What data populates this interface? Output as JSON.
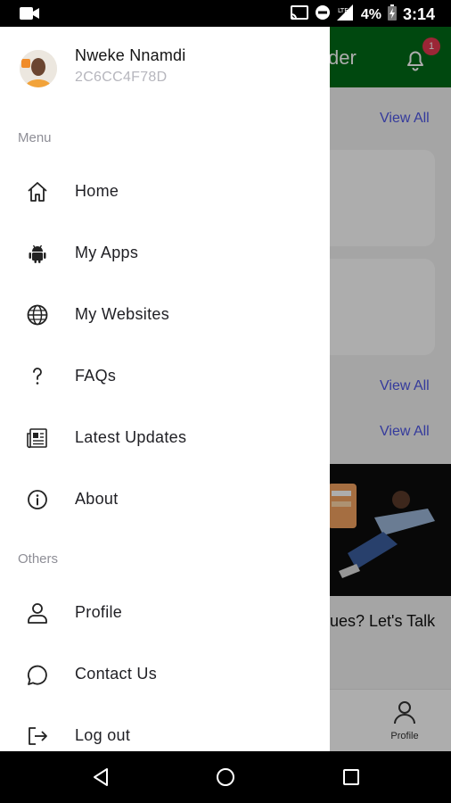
{
  "status_bar": {
    "battery_text": "4%",
    "time": "3:14"
  },
  "background_app": {
    "header_title_partial": "der",
    "notification_count": "1",
    "view_all_label": "View All",
    "promo_text_partial": "ues? Let's Talk",
    "bottom_nav_profile_label": "Profile",
    "colors": {
      "header": "#006a17",
      "link": "#4d56e6",
      "badge": "#e53950"
    }
  },
  "drawer": {
    "user": {
      "name": "Nweke Nnamdi",
      "id": "2C6CC4F78D"
    },
    "sections": [
      {
        "title": "Menu",
        "items": [
          {
            "label": "Home",
            "icon": "home-icon"
          },
          {
            "label": "My Apps",
            "icon": "android-icon"
          },
          {
            "label": "My Websites",
            "icon": "globe-icon"
          },
          {
            "label": "FAQs",
            "icon": "question-icon"
          },
          {
            "label": "Latest Updates",
            "icon": "newspaper-icon"
          },
          {
            "label": "About",
            "icon": "info-icon"
          }
        ]
      },
      {
        "title": "Others",
        "items": [
          {
            "label": "Profile",
            "icon": "user-icon"
          },
          {
            "label": "Contact Us",
            "icon": "chat-bubble-icon"
          },
          {
            "label": "Log out",
            "icon": "logout-icon"
          }
        ]
      }
    ]
  }
}
